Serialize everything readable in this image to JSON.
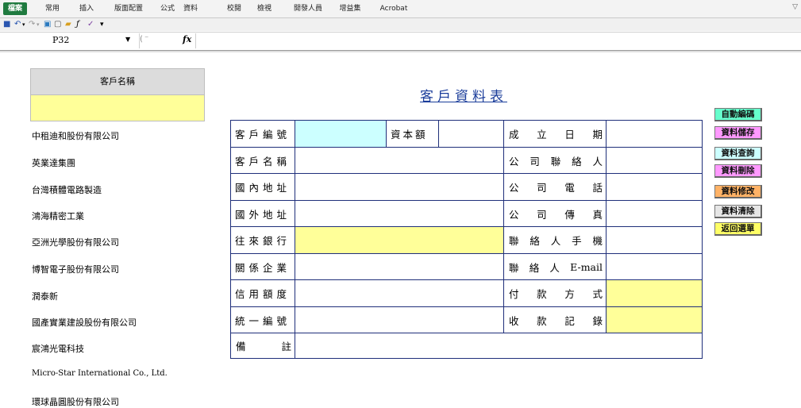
{
  "ribbon": {
    "tabs": [
      "檔案",
      "常用",
      "插入",
      "版面配置",
      "公式",
      "資料",
      "校閱",
      "檢視",
      "開發人員",
      "增益集",
      "Acrobat"
    ],
    "collapse_label": "▽"
  },
  "formula_bar": {
    "cell_ref": "P32",
    "fx_label": "fx",
    "formula": ""
  },
  "customer_panel": {
    "header": "客戶名稱",
    "input_value": "",
    "customers": [
      "中租迪和股份有限公司",
      "英業達集團",
      "台灣積體電路製造",
      "鴻海精密工業",
      "亞洲光學股份有限公司",
      "博智電子股份有限公司",
      "潤泰新",
      "國產實業建設股份有限公司",
      "宸鴻光電科技",
      "Micro-Star International Co., Ltd.",
      "環球晶圓股份有限公司"
    ]
  },
  "form": {
    "title": "客戶資料表",
    "labels": {
      "customer_no": "客戶編號",
      "capital": "資本額",
      "founded_date": [
        "成",
        "立",
        "日",
        "期"
      ],
      "customer_name": "客戶名稱",
      "contact_person": [
        "公",
        "司",
        "聯",
        "絡",
        "人"
      ],
      "domestic_address": "國內地址",
      "company_phone": [
        "公",
        "司",
        "電",
        "話"
      ],
      "foreign_address": "國外地址",
      "company_fax": [
        "公",
        "司",
        "傳",
        "真"
      ],
      "bank": "往來銀行",
      "contact_mobile": [
        "聯",
        "絡",
        "人",
        "手",
        "機"
      ],
      "affiliates": "關係企業",
      "contact_email": [
        "聯",
        "絡",
        "人",
        "E-mail"
      ],
      "credit_limit": "信用額度",
      "payment_method": [
        "付",
        "款",
        "方",
        "式"
      ],
      "tax_id": "統一編號",
      "collection_record": [
        "收",
        "款",
        "記",
        "錄"
      ],
      "remarks": [
        "備",
        "註"
      ]
    },
    "values": {
      "customer_no": "",
      "capital": "",
      "founded_date": "",
      "customer_name": "",
      "contact_person": "",
      "domestic_address": "",
      "company_phone": "",
      "foreign_address": "",
      "company_fax": "",
      "bank": "",
      "contact_mobile": "",
      "affiliates": "",
      "contact_email": "",
      "credit_limit": "",
      "payment_method": "",
      "tax_id": "",
      "collection_record": "",
      "remarks": ""
    }
  },
  "actions": [
    {
      "label": "自動編碼",
      "color": "#66ffcc"
    },
    {
      "label": "資料儲存",
      "color": "#ff99ff"
    },
    {
      "label": "資料查詢",
      "color": "#ccffff"
    },
    {
      "label": "資料刪除",
      "color": "#ff99ff"
    },
    {
      "label": "資料修改",
      "color": "#ffb266"
    },
    {
      "label": "資料清除",
      "color": "#e6e6e6"
    },
    {
      "label": "返回選單",
      "color": "#ffff66"
    }
  ],
  "colors": {
    "border": "#1f2f7a",
    "title": "#1a3c9a",
    "highlight_yellow": "#ffff99",
    "highlight_cyan": "#ccffff"
  }
}
